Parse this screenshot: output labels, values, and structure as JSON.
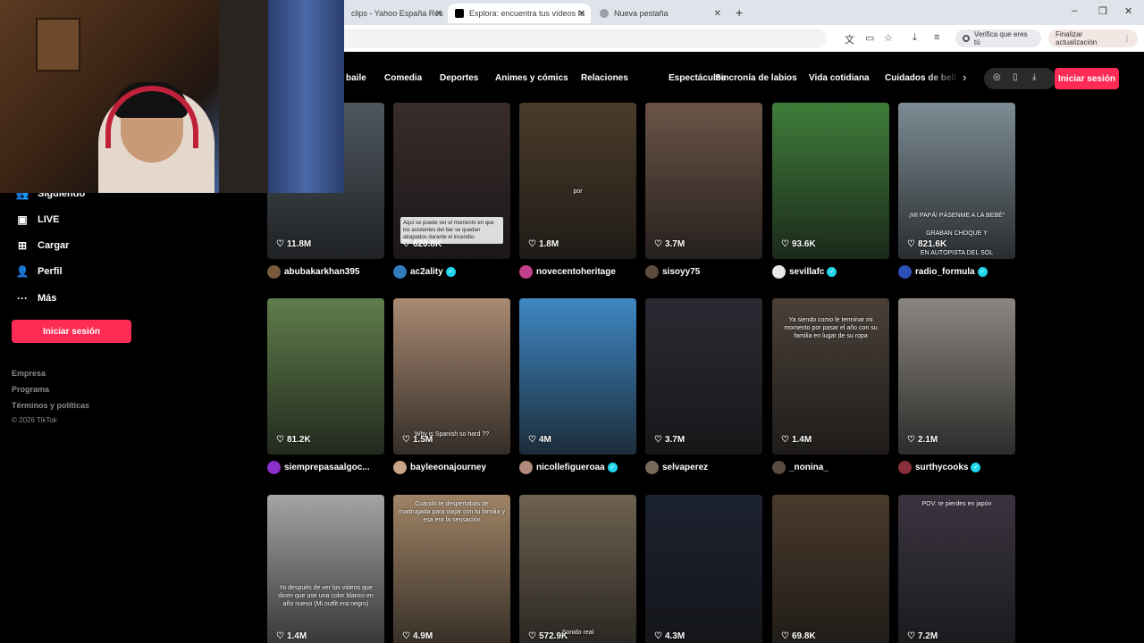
{
  "browser": {
    "tabs": [
      {
        "label": "clips - Yahoo España Res",
        "favicon_color": "#6001d2",
        "active": false
      },
      {
        "label": "Explora: encuentra tus vídeos fa",
        "favicon_color": "#000000",
        "active": true
      },
      {
        "label": "Nueva pestaña",
        "favicon_color": "#9aa0a6",
        "active": false
      }
    ],
    "newtab_icon": "plus-icon",
    "window_controls": [
      "minimize-icon",
      "maximize-icon",
      "close-icon"
    ],
    "verify_label": "Verifica que eres tú",
    "update_label": "Finalizar actualización"
  },
  "topnav": {
    "categories": [
      "baile",
      "Comedia",
      "Deportes",
      "Animes y cómics",
      "Relaciones",
      "Espectáculos",
      "Sincronía de labios",
      "Vida cotidiana",
      "Cuidados de belle"
    ],
    "login_label": "Iniciar sesión",
    "accent": "#fe2c55"
  },
  "sidebar": {
    "items": [
      {
        "label": "Siguiendo",
        "icon": "users-icon"
      },
      {
        "label": "LIVE",
        "icon": "live-icon"
      },
      {
        "label": "Cargar",
        "icon": "upload-icon"
      },
      {
        "label": "Perfil",
        "icon": "profile-icon"
      },
      {
        "label": "Más",
        "icon": "more-icon"
      }
    ],
    "login_label": "Iniciar sesión",
    "footer_links": [
      "Empresa",
      "Programa",
      "Términos y políticas"
    ],
    "copyright": "© 2026 TikTok"
  },
  "videos": [
    {
      "views": "11.8M",
      "author": "abubakarkhan395",
      "verified": false,
      "thumb": "#4f5860",
      "avatar": "#7a5a3c"
    },
    {
      "views": "620.8K",
      "author": "ac2ality",
      "verified": true,
      "thumb": "#3a2c2c",
      "avatar": "#2f7dbf"
    },
    {
      "views": "1.8M",
      "author": "novecentoheritage",
      "verified": false,
      "thumb": "#4b3c2a",
      "avatar": "#c2408a"
    },
    {
      "views": "3.7M",
      "author": "sisoyy75",
      "verified": false,
      "thumb": "#6b5447",
      "avatar": "#5b4a3e"
    },
    {
      "views": "93.6K",
      "author": "sevillafc",
      "verified": true,
      "thumb": "#3f7d3a",
      "avatar": "#e8e8e8"
    },
    {
      "views": "821.6K",
      "author": "radio_formula",
      "verified": true,
      "thumb": "#7d8c95",
      "avatar": "#2c4fb8"
    },
    {
      "views": "81.2K",
      "author": "siemprepasaalgoc...",
      "verified": false,
      "thumb": "#5f7d4a",
      "avatar": "#8a2fc7"
    },
    {
      "views": "1.5M",
      "author": "bayleeonajourney",
      "verified": false,
      "thumb": "#a98a72",
      "avatar": "#c9a385"
    },
    {
      "views": "4M",
      "author": "nicollefigueroaa",
      "verified": true,
      "thumb": "#3f88c4",
      "avatar": "#b08a7a"
    },
    {
      "views": "3.7M",
      "author": "selvaperez",
      "verified": false,
      "thumb": "#2a2a33",
      "avatar": "#7a6a5a"
    },
    {
      "views": "1.4M",
      "author": "_nonina_",
      "verified": false,
      "thumb": "#4a4038",
      "avatar": "#5a4a40"
    },
    {
      "views": "2.1M",
      "author": "surthycooks",
      "verified": true,
      "thumb": "#8a8680",
      "avatar": "#8a2f3a"
    },
    {
      "views": "1.4M",
      "author": "",
      "verified": false,
      "thumb": "#a3a4a6",
      "avatar": "#555"
    },
    {
      "views": "4.9M",
      "author": "",
      "verified": false,
      "thumb": "#a08466",
      "avatar": "#555"
    },
    {
      "views": "572.9K",
      "author": "",
      "verified": false,
      "thumb": "#6e6250",
      "avatar": "#555"
    },
    {
      "views": "4.3M",
      "author": "",
      "verified": false,
      "thumb": "#1c2230",
      "avatar": "#555"
    },
    {
      "views": "69.8K",
      "author": "",
      "verified": false,
      "thumb": "#4a3a2c",
      "avatar": "#555"
    },
    {
      "views": "7.2M",
      "author": "",
      "verified": false,
      "thumb": "#3a3440",
      "avatar": "#555"
    }
  ],
  "overlays": {
    "v2": "Aquí se puede ver el momento en que los asistentes del bar se quedan atrapados durante el incendio.",
    "v3": "por",
    "v6_a": "¡MI PAPÁ! PÁSENME A LA BEBÉ\"",
    "v6_b": "GRABAN CHOQUE Y",
    "v6_c": "EN AUTOPISTA DEL SOL",
    "v8": "Why is Spanish so hard ??",
    "v11": "Ya siendo como le terminar mi momento por pasar el año con su familia en lugar de su ropa",
    "v13": "Yo después de ver los videos que dicen que use una color blanco en año nuevo (Mi outfit era negro)",
    "v14": "Cuando te despertabas de madrugada para viajar con tu familia y esa era la sensación",
    "v15": "Sonido real",
    "v18": "POV: te pierdes en japón"
  }
}
